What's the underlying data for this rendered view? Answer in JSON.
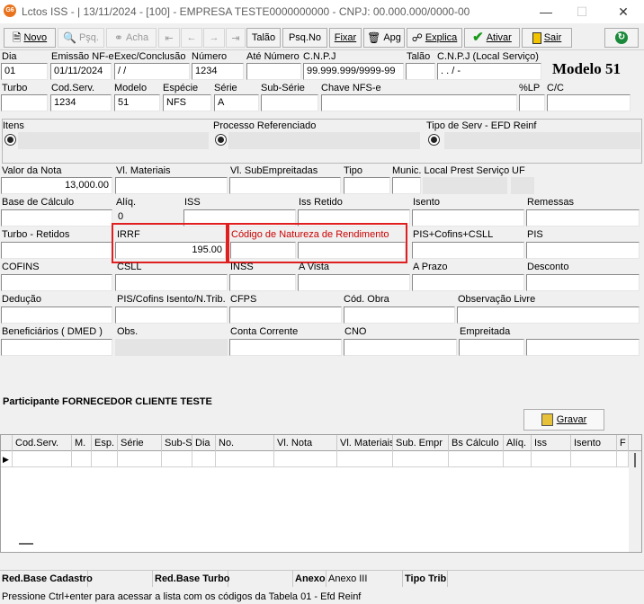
{
  "window": {
    "app_icon": "G6",
    "title": "Lctos ISS - |  13/11/2024 - [100] - EMPRESA TESTE0000000000 - CNPJ: 00.000.000/0000-00",
    "minimize_icon": "minimize-icon",
    "maximize_icon": "maximize-icon",
    "close_icon": "close-icon"
  },
  "toolbar": {
    "novo": "Novo",
    "pesq": "Pşq.",
    "acha": "Acha",
    "talao": "Talão",
    "psqno": "Psq.No",
    "fixar": "Fixar",
    "apg": "Apg",
    "explica": "Explica",
    "ativar": "Ativar",
    "sair": "Sair",
    "colors": {
      "ativar_check": "#1a9a1a",
      "refresh": "#1a8a3a"
    }
  },
  "header": {
    "modelo_title": "Modelo 51",
    "labels": {
      "dia": "Dia",
      "emissao": "Emissão NF-e",
      "exec": "Exec/Conclusão",
      "numero": "Número",
      "ate_numero": "Até Número",
      "cnpj": "C.N.P.J",
      "talao": "Talão",
      "cnpj_local": "C.N.P.J (Local Serviço)",
      "turbo": "Turbo",
      "cod_serv": "Cod.Serv.",
      "modelo": "Modelo",
      "especie": "Espécie",
      "serie": "Série",
      "sub_serie": "Sub-Série",
      "chave_nfse": "Chave NFS-e",
      "lp": "%LP",
      "cc": "C/C"
    },
    "values": {
      "dia": "01",
      "emissao": "01/11/2024",
      "exec": " /  /",
      "numero": "1234",
      "ate_numero": "",
      "cnpj": "99.999.999/9999-99",
      "talao": "",
      "cnpj_local": " .  .  /  -",
      "turbo": "",
      "cod_serv": "1234",
      "modelo": "51",
      "especie": "NFS",
      "serie": "A",
      "sub_serie": "",
      "chave_nfse": "",
      "lp": "",
      "cc": ""
    }
  },
  "group": {
    "itens": "Itens",
    "processo": "Processo Referenciado",
    "tipo_serv": "Tipo de Serv - EFD Reinf"
  },
  "fields": {
    "labels": {
      "valor_nota": "Valor da Nota",
      "vl_materiais": "Vl. Materiais",
      "vl_subemp": "Vl. SubEmpreitadas",
      "tipo": "Tipo",
      "munic": "Munic. Local Prest Serviço",
      "uf": "UF",
      "base_calc": "Base de Cálculo",
      "aliq": "Alíq.",
      "iss": "ISS",
      "iss_retido": "Iss Retido",
      "isento": "Isento",
      "remessas": "Remessas",
      "turbo_retidos": "Turbo - Retidos",
      "irrf": "IRRF",
      "cod_natureza": "Código de Natureza de Rendimento",
      "pis_cofins_csll": "PIS+Cofins+CSLL",
      "pis": "PIS",
      "cofins": "COFINS",
      "csll": "CSLL",
      "inss": "INSS",
      "a_vista": "A Vista",
      "a_prazo": "A Prazo",
      "desconto": "Desconto",
      "deducao": "Dedução",
      "pis_cofins_isento": "PIS/Cofins Isento/N.Trib.",
      "cfps": "CFPS",
      "cod_obra": "Cód. Obra",
      "obs_livre": "Observação Livre",
      "beneficiarios": "Beneficiários ( DMED )",
      "obs": "Obs.",
      "conta_corrente": "Conta Corrente",
      "cno": "CNO",
      "empreitada": "Empreitada"
    },
    "values": {
      "valor_nota": "13,000.00",
      "aliq": "0",
      "irrf": "195.00"
    },
    "colors": {
      "highlight": "#e02020",
      "red_label": "#cc0000"
    }
  },
  "participante": {
    "label": "Participante FORNECEDOR CLIENTE TESTE",
    "gravar": "Gravar"
  },
  "grid": {
    "columns": [
      "Cod.Serv.",
      "M.",
      "Esp.",
      "Série",
      "Sub-S",
      "Dia",
      "No.",
      "Vl. Nota",
      "Vl. Materiais",
      "Sub. Empr",
      "Bs Cálculo",
      "Alíq.",
      "Iss",
      "Isento",
      "F"
    ]
  },
  "status": {
    "red_base_cadastro": "Red.Base Cadastro",
    "red_base_turbo": "Red.Base Turbo",
    "anexo": "Anexo",
    "anexo_iii": "Anexo III",
    "tipo_trib": "Tipo Trib",
    "hint": "Pressione Ctrl+enter para acessar a lista com os códigos da Tabela 01 - Efd Reinf"
  }
}
